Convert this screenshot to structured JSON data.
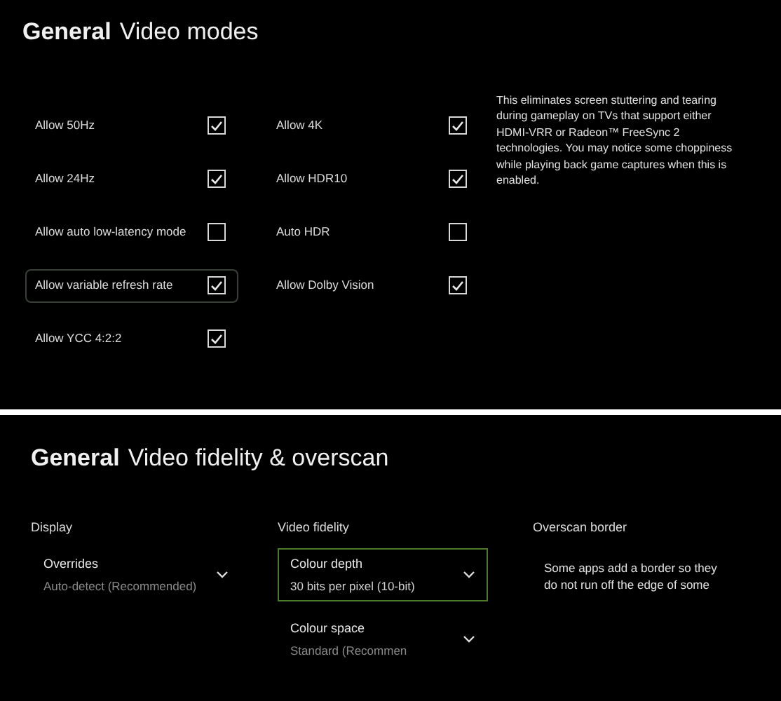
{
  "video_modes": {
    "title_bold": "General",
    "title": "Video modes",
    "columns": [
      [
        {
          "label": "Allow 50Hz",
          "checked": true,
          "selected": false
        },
        {
          "label": "Allow 24Hz",
          "checked": true,
          "selected": false
        },
        {
          "label": "Allow auto low-latency mode",
          "checked": false,
          "selected": false
        },
        {
          "label": "Allow variable refresh rate",
          "checked": true,
          "selected": true
        },
        {
          "label": "Allow YCC 4:2:2",
          "checked": true,
          "selected": false
        }
      ],
      [
        {
          "label": "Allow 4K",
          "checked": true,
          "selected": false
        },
        {
          "label": "Allow HDR10",
          "checked": true,
          "selected": false
        },
        {
          "label": "Auto HDR",
          "checked": false,
          "selected": false
        },
        {
          "label": "Allow Dolby Vision",
          "checked": true,
          "selected": false
        }
      ]
    ],
    "description": "This eliminates screen stuttering and tearing during gameplay on TVs that support either HDMI-VRR or Radeon™ FreeSync 2 technologies. You may notice some choppiness while playing back game captures when this is enabled."
  },
  "fidelity": {
    "title_bold": "General",
    "title": "Video fidelity & overscan",
    "display": {
      "heading": "Display",
      "dropdowns": [
        {
          "label": "Overrides",
          "value": "Auto-detect (Recommended)",
          "selected": false
        }
      ]
    },
    "video_fidelity": {
      "heading": "Video fidelity",
      "dropdowns": [
        {
          "label": "Colour depth",
          "value": "30 bits per pixel (10-bit)",
          "selected": true
        },
        {
          "label": "Colour space",
          "value": "Standard (Recommen",
          "selected": false
        }
      ]
    },
    "overscan": {
      "heading": "Overscan border",
      "text": "Some apps add a border so they do not run off the edge of some"
    }
  }
}
